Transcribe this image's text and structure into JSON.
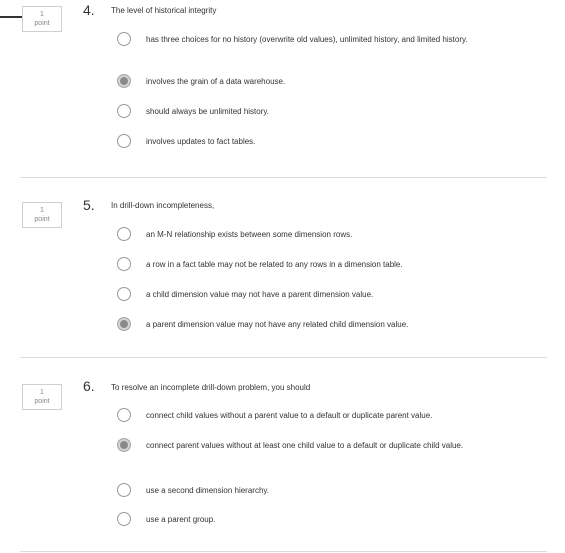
{
  "questions": [
    {
      "number": "4.",
      "points_value": "1",
      "points_label": "point",
      "text": "The level of historical integrity",
      "options": [
        {
          "label": "has three choices for no history (overwrite old values), unlimited history, and limited history.",
          "selected": false
        },
        {
          "label": "involves the grain of a data warehouse.",
          "selected": true
        },
        {
          "label": "should always be unlimited history.",
          "selected": false
        },
        {
          "label": "involves updates to fact tables.",
          "selected": false
        }
      ]
    },
    {
      "number": "5.",
      "points_value": "1",
      "points_label": "point",
      "text": "In drill-down incompleteness,",
      "options": [
        {
          "label": "an M-N relationship exists between some dimension rows.",
          "selected": false
        },
        {
          "label": "a row in a fact table may not be related to any rows in a dimension table.",
          "selected": false
        },
        {
          "label": "a child dimension value may not have a parent dimension value.",
          "selected": false
        },
        {
          "label": "a parent dimension value may not have any related child dimension value.",
          "selected": true
        }
      ]
    },
    {
      "number": "6.",
      "points_value": "1",
      "points_label": "point",
      "text": "To resolve an incomplete drill-down problem, you should",
      "options": [
        {
          "label": "connect child values without a parent value to a default or duplicate parent value.",
          "selected": false
        },
        {
          "label": "connect parent values without at least one child value to a default or duplicate child value.",
          "selected": true
        },
        {
          "label": "use a second dimension hierarchy.",
          "selected": false
        },
        {
          "label": "use a parent group.",
          "selected": false
        }
      ]
    }
  ]
}
